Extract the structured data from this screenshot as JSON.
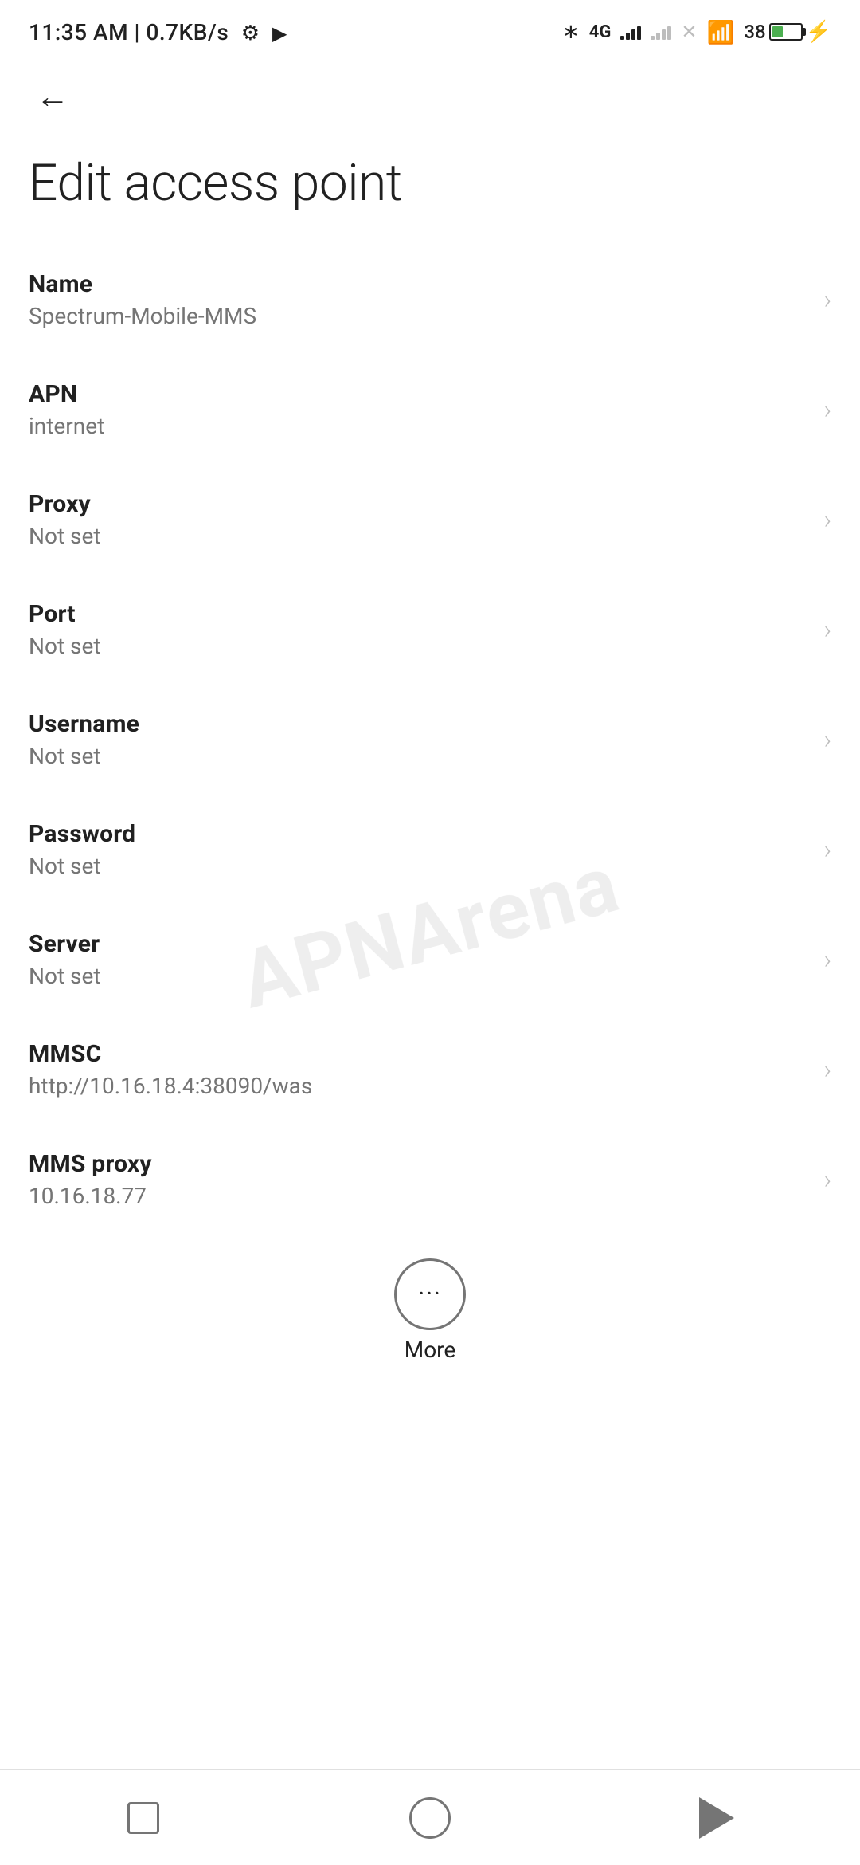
{
  "statusBar": {
    "time": "11:35 AM",
    "speed": "0.7KB/s"
  },
  "page": {
    "title": "Edit access point",
    "backLabel": "Back"
  },
  "fields": [
    {
      "id": "name",
      "label": "Name",
      "value": "Spectrum-Mobile-MMS"
    },
    {
      "id": "apn",
      "label": "APN",
      "value": "internet"
    },
    {
      "id": "proxy",
      "label": "Proxy",
      "value": "Not set"
    },
    {
      "id": "port",
      "label": "Port",
      "value": "Not set"
    },
    {
      "id": "username",
      "label": "Username",
      "value": "Not set"
    },
    {
      "id": "password",
      "label": "Password",
      "value": "Not set"
    },
    {
      "id": "server",
      "label": "Server",
      "value": "Not set"
    },
    {
      "id": "mmsc",
      "label": "MMSC",
      "value": "http://10.16.18.4:38090/was"
    },
    {
      "id": "mms-proxy",
      "label": "MMS proxy",
      "value": "10.16.18.77"
    }
  ],
  "more": {
    "label": "More"
  },
  "watermark": "APNArena",
  "bottomNav": {
    "square": "recent-apps",
    "circle": "home",
    "triangle": "back"
  }
}
